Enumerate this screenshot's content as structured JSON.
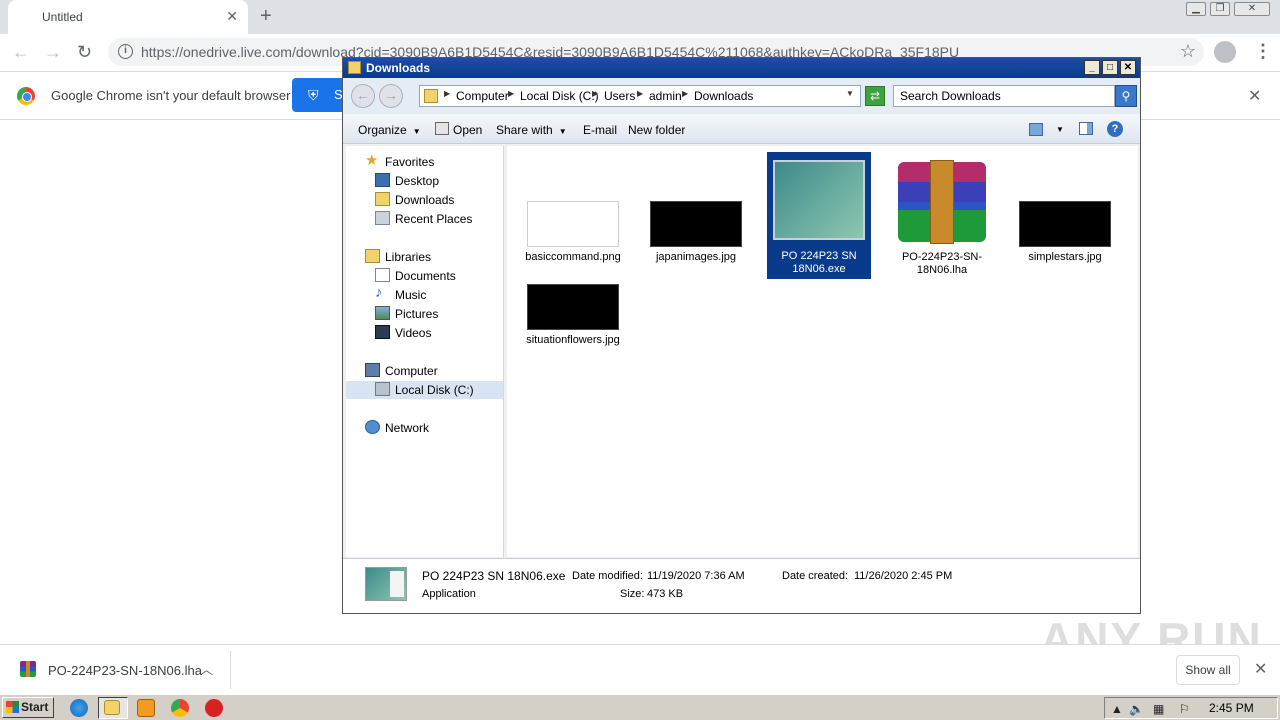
{
  "browser": {
    "tab_title": "Untitled",
    "tab_close": "✕",
    "new_tab": "+",
    "url": "https://onedrive.live.com/download?cid=3090B9A6B1D5454C&resid=3090B9A6B1D5454C%211068&authkey=ACkoDRa_35F18PU",
    "infobar_message": "Google Chrome isn't your default browser",
    "set_default_label": "S",
    "infobar_close": "✕"
  },
  "explorer": {
    "title": "Downloads",
    "breadcrumbs": [
      "Computer",
      "Local Disk (C:)",
      "Users",
      "admin",
      "Downloads"
    ],
    "search_placeholder": "Search Downloads",
    "commands": {
      "organize": "Organize",
      "open": "Open",
      "share_with": "Share with",
      "email": "E-mail",
      "new_folder": "New folder"
    },
    "nav": {
      "favorites": "Favorites",
      "desktop": "Desktop",
      "downloads": "Downloads",
      "recent_places": "Recent Places",
      "libraries": "Libraries",
      "documents": "Documents",
      "music": "Music",
      "pictures": "Pictures",
      "videos": "Videos",
      "computer": "Computer",
      "local_disk": "Local Disk (C:)",
      "network": "Network"
    },
    "files": [
      {
        "name": "basiccommand.png",
        "icon": "white-image-thumbnail"
      },
      {
        "name": "japanimages.jpg",
        "icon": "black-image-thumbnail"
      },
      {
        "name": "PO 224P23 SN 18N06.exe",
        "icon": "application-thumbnail",
        "selected": true
      },
      {
        "name": "PO-224P23-SN-18N06.lha",
        "icon": "winrar-archive-icon"
      },
      {
        "name": "simplestars.jpg",
        "icon": "black-image-thumbnail"
      },
      {
        "name": "situationflowers.jpg",
        "icon": "black-image-thumbnail"
      }
    ],
    "details": {
      "name": "PO 224P23 SN 18N06.exe",
      "type": "Application",
      "date_modified_label": "Date modified:",
      "date_modified": "11/19/2020 7:36 AM",
      "size_label": "Size:",
      "size": "473 KB",
      "date_created_label": "Date created:",
      "date_created": "11/26/2020 2:45 PM"
    }
  },
  "download_bar": {
    "file_name": "PO-224P23-SN-18N06.lha",
    "show_all": "Show all"
  },
  "watermark": "ANY RUN",
  "taskbar": {
    "start": "Start",
    "clock": "2:45 PM"
  },
  "colors": {
    "chrome_accent": "#1a73e8",
    "xp_titlebar": "#0a3a8b",
    "selection": "#0a3a8b"
  }
}
